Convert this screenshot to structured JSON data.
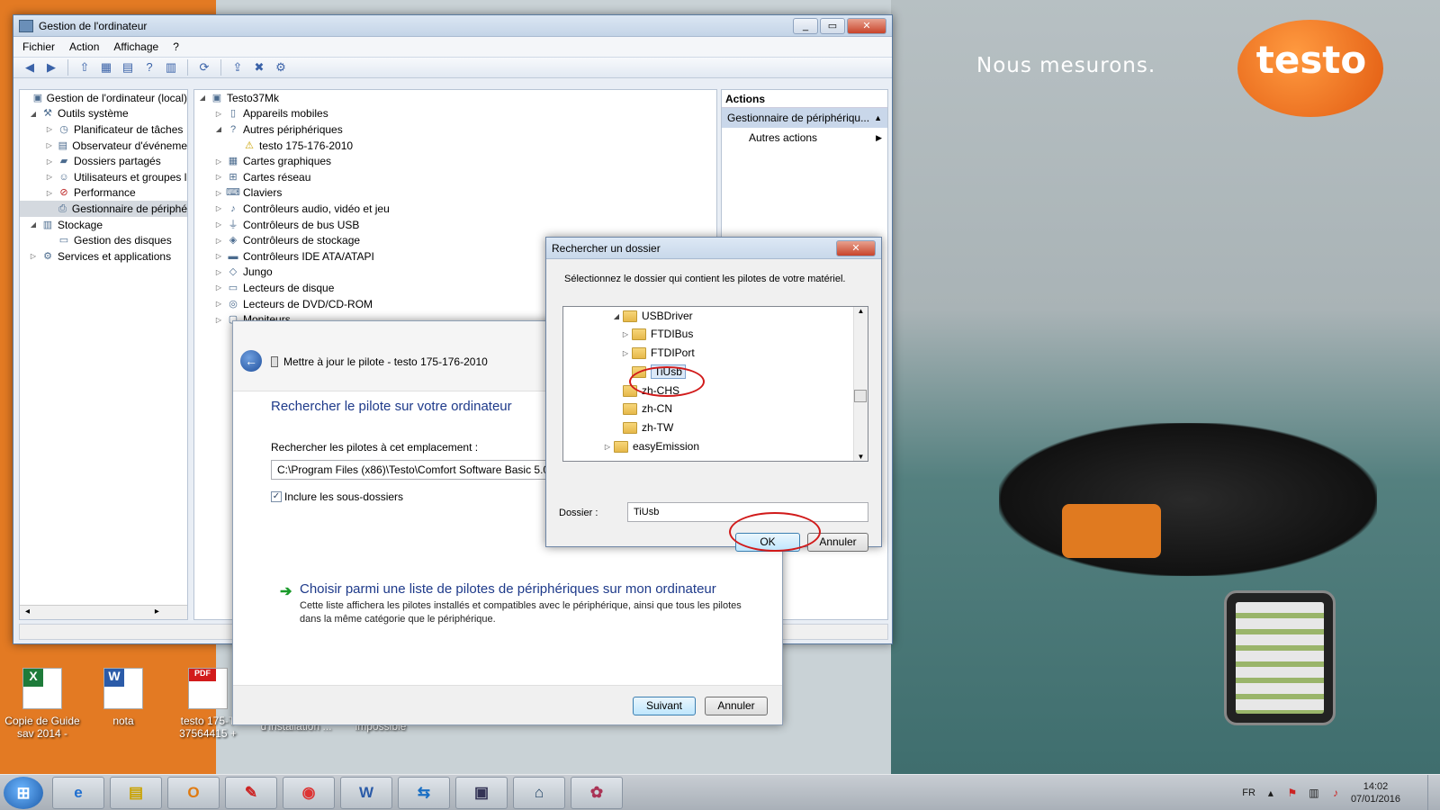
{
  "wallpaper": {
    "slogan": "Nous mesurons.",
    "logo": "testo"
  },
  "desktop_icons": [
    {
      "label": "Copie de Guide sav 2014 -",
      "icon": "excel-icon"
    },
    {
      "label": "nota",
      "icon": "word-icon"
    },
    {
      "label": "testo 175-T 37564415 +",
      "icon": "pdf-icon"
    },
    {
      "label": "d'installation ...",
      "icon": ""
    },
    {
      "label": "impossible",
      "icon": ""
    }
  ],
  "computer_management": {
    "title": "Gestion de l'ordinateur",
    "menu": [
      "Fichier",
      "Action",
      "Affichage",
      "?"
    ],
    "left_tree": [
      {
        "label": "Gestion de l'ordinateur (local)",
        "arrow": "",
        "icon": "computer-icon"
      },
      {
        "label": "Outils système",
        "arrow": "◢",
        "icon": "tools-icon"
      },
      {
        "label": "Planificateur de tâches",
        "arrow": "▷",
        "icon": "clock-icon"
      },
      {
        "label": "Observateur d'événeme",
        "arrow": "▷",
        "icon": "event-viewer-icon"
      },
      {
        "label": "Dossiers partagés",
        "arrow": "▷",
        "icon": "shared-folder-icon"
      },
      {
        "label": "Utilisateurs et groupes l",
        "arrow": "▷",
        "icon": "users-icon"
      },
      {
        "label": "Performance",
        "arrow": "▷",
        "icon": "performance-icon"
      },
      {
        "label": "Gestionnaire de périphé",
        "arrow": "",
        "icon": "device-manager-icon",
        "selected": true
      },
      {
        "label": "Stockage",
        "arrow": "◢",
        "icon": "storage-icon"
      },
      {
        "label": "Gestion des disques",
        "arrow": "",
        "icon": "disk-icon"
      },
      {
        "label": "Services et applications",
        "arrow": "▷",
        "icon": "services-icon"
      }
    ],
    "device_tree": [
      {
        "label": "Testo37Mk",
        "arrow": "◢",
        "icon": "computer-icon"
      },
      {
        "label": "Appareils mobiles",
        "arrow": "▷",
        "icon": "mobile-icon"
      },
      {
        "label": "Autres périphériques",
        "arrow": "◢",
        "icon": "other-devices-icon"
      },
      {
        "label": "testo 175-176-2010",
        "arrow": "",
        "icon": "warning-device-icon"
      },
      {
        "label": "Cartes graphiques",
        "arrow": "▷",
        "icon": "display-adapter-icon"
      },
      {
        "label": "Cartes réseau",
        "arrow": "▷",
        "icon": "network-icon"
      },
      {
        "label": "Claviers",
        "arrow": "▷",
        "icon": "keyboard-icon"
      },
      {
        "label": "Contrôleurs audio, vidéo et jeu",
        "arrow": "▷",
        "icon": "audio-icon"
      },
      {
        "label": "Contrôleurs de bus USB",
        "arrow": "▷",
        "icon": "usb-icon"
      },
      {
        "label": "Contrôleurs de stockage",
        "arrow": "▷",
        "icon": "storage-controller-icon"
      },
      {
        "label": "Contrôleurs IDE ATA/ATAPI",
        "arrow": "▷",
        "icon": "ide-icon"
      },
      {
        "label": "Jungo",
        "arrow": "▷",
        "icon": "jungo-icon"
      },
      {
        "label": "Lecteurs de disque",
        "arrow": "▷",
        "icon": "disk-drive-icon"
      },
      {
        "label": "Lecteurs de DVD/CD-ROM",
        "arrow": "▷",
        "icon": "dvd-icon"
      },
      {
        "label": "Moniteurs",
        "arrow": "▷",
        "icon": "monitor-icon"
      }
    ],
    "actions": {
      "header": "Actions",
      "selected": "Gestionnaire de périphériqu...",
      "more": "Autres actions"
    }
  },
  "wizard": {
    "title": "Mettre à jour le pilote - testo 175-176-2010",
    "heading": "Rechercher le pilote sur votre ordinateur",
    "location_label": "Rechercher les pilotes à cet emplacement :",
    "path": "C:\\Program Files (x86)\\Testo\\Comfort Software Basic 5.0\\",
    "include_subfolders": "Inclure les sous-dossiers",
    "include_subfolders_checked": true,
    "choose_link": "Choisir parmi une liste de pilotes de périphériques sur mon ordinateur",
    "choose_desc": "Cette liste affichera les pilotes installés et compatibles avec le périphérique, ainsi que tous les pilotes dans la même catégorie que le périphérique.",
    "next_button": "Suivant",
    "cancel_button": "Annuler"
  },
  "browse": {
    "title": "Rechercher un dossier",
    "instruction": "Sélectionnez le dossier qui contient les pilotes de votre matériel.",
    "folders": [
      {
        "label": "USBDriver",
        "arrow": "◢"
      },
      {
        "label": "FTDIBus",
        "arrow": "▷"
      },
      {
        "label": "FTDIPort",
        "arrow": "▷"
      },
      {
        "label": "TiUsb",
        "arrow": "",
        "selected": true
      },
      {
        "label": "zh-CHS",
        "arrow": ""
      },
      {
        "label": "zh-CN",
        "arrow": ""
      },
      {
        "label": "zh-TW",
        "arrow": ""
      },
      {
        "label": "easyEmission",
        "arrow": "▷"
      }
    ],
    "folder_label": "Dossier :",
    "folder_value": "TiUsb",
    "ok_button": "OK",
    "cancel_button": "Annuler"
  },
  "taskbar": {
    "start": "start-button",
    "apps": [
      "internet-explorer-icon",
      "explorer-icon",
      "outlook-icon",
      "pen-drive-icon",
      "chrome-icon",
      "word-icon",
      "teamviewer-icon",
      "remote-desktop-icon",
      "network-icon",
      "paint-icon"
    ],
    "language": "FR",
    "time": "14:02",
    "date": "07/01/2016"
  },
  "colors": {
    "desktop_orange": "#e37a23",
    "highlight_red": "#d11a1a",
    "link_blue": "#1e3a8a"
  }
}
